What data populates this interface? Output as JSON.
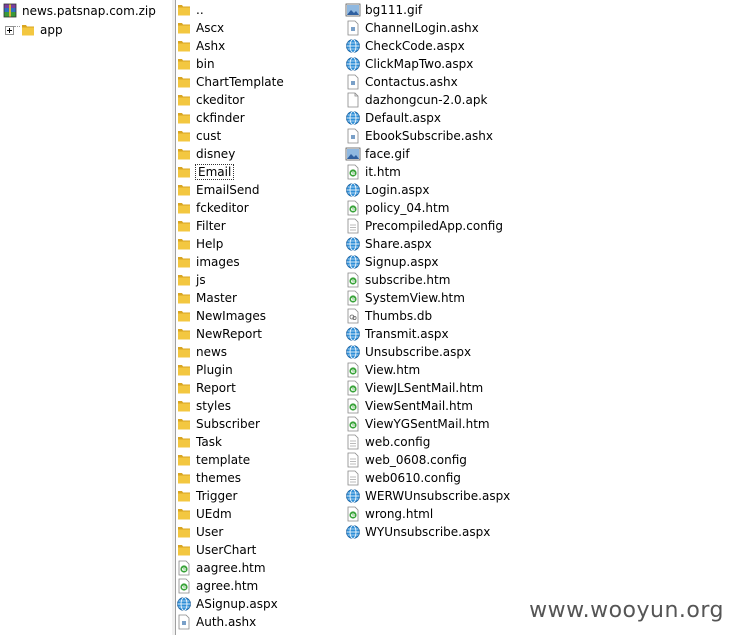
{
  "tree": {
    "root_label": "news.patsnap.com.zip",
    "child_label": "app"
  },
  "column1": [
    {
      "name": "..",
      "icon": "folder-icon"
    },
    {
      "name": "Ascx",
      "icon": "folder-icon"
    },
    {
      "name": "Ashx",
      "icon": "folder-icon"
    },
    {
      "name": "bin",
      "icon": "folder-icon"
    },
    {
      "name": "ChartTemplate",
      "icon": "folder-icon"
    },
    {
      "name": "ckeditor",
      "icon": "folder-icon"
    },
    {
      "name": "ckfinder",
      "icon": "folder-icon"
    },
    {
      "name": "cust",
      "icon": "folder-icon"
    },
    {
      "name": "disney",
      "icon": "folder-icon"
    },
    {
      "name": "Email",
      "icon": "folder-icon",
      "selected": true
    },
    {
      "name": "EmailSend",
      "icon": "folder-icon"
    },
    {
      "name": "fckeditor",
      "icon": "folder-icon"
    },
    {
      "name": "Filter",
      "icon": "folder-icon"
    },
    {
      "name": "Help",
      "icon": "folder-icon"
    },
    {
      "name": "images",
      "icon": "folder-icon"
    },
    {
      "name": "js",
      "icon": "folder-icon"
    },
    {
      "name": "Master",
      "icon": "folder-icon"
    },
    {
      "name": "NewImages",
      "icon": "folder-icon"
    },
    {
      "name": "NewReport",
      "icon": "folder-icon"
    },
    {
      "name": "news",
      "icon": "folder-icon"
    },
    {
      "name": "Plugin",
      "icon": "folder-icon"
    },
    {
      "name": "Report",
      "icon": "folder-icon"
    },
    {
      "name": "styles",
      "icon": "folder-icon"
    },
    {
      "name": "Subscriber",
      "icon": "folder-icon"
    },
    {
      "name": "Task",
      "icon": "folder-icon"
    },
    {
      "name": "template",
      "icon": "folder-icon"
    },
    {
      "name": "themes",
      "icon": "folder-icon"
    },
    {
      "name": "Trigger",
      "icon": "folder-icon"
    },
    {
      "name": "UEdm",
      "icon": "folder-icon"
    },
    {
      "name": "User",
      "icon": "folder-icon"
    },
    {
      "name": "UserChart",
      "icon": "folder-icon"
    },
    {
      "name": "aagree.htm",
      "icon": "html-file-icon"
    },
    {
      "name": "agree.htm",
      "icon": "html-file-icon"
    },
    {
      "name": "ASignup.aspx",
      "icon": "aspx-file-icon"
    },
    {
      "name": "Auth.ashx",
      "icon": "ashx-file-icon"
    }
  ],
  "column2": [
    {
      "name": "bg111.gif",
      "icon": "image-file-icon"
    },
    {
      "name": "ChannelLogin.ashx",
      "icon": "ashx-file-icon"
    },
    {
      "name": "CheckCode.aspx",
      "icon": "aspx-file-icon"
    },
    {
      "name": "ClickMapTwo.aspx",
      "icon": "aspx-file-icon"
    },
    {
      "name": "Contactus.ashx",
      "icon": "ashx-file-icon"
    },
    {
      "name": "dazhongcun-2.0.apk",
      "icon": "blank-file-icon"
    },
    {
      "name": "Default.aspx",
      "icon": "aspx-file-icon"
    },
    {
      "name": "EbookSubscribe.ashx",
      "icon": "ashx-file-icon"
    },
    {
      "name": "face.gif",
      "icon": "image-file-icon"
    },
    {
      "name": "it.htm",
      "icon": "html-file-icon"
    },
    {
      "name": "Login.aspx",
      "icon": "aspx-file-icon"
    },
    {
      "name": "policy_04.htm",
      "icon": "html-file-icon"
    },
    {
      "name": "PrecompiledApp.config",
      "icon": "config-file-icon"
    },
    {
      "name": "Share.aspx",
      "icon": "aspx-file-icon"
    },
    {
      "name": "Signup.aspx",
      "icon": "aspx-file-icon"
    },
    {
      "name": "subscribe.htm",
      "icon": "html-file-icon"
    },
    {
      "name": "SystemView.htm",
      "icon": "html-file-icon"
    },
    {
      "name": "Thumbs.db",
      "icon": "db-file-icon"
    },
    {
      "name": "Transmit.aspx",
      "icon": "aspx-file-icon"
    },
    {
      "name": "Unsubscribe.aspx",
      "icon": "aspx-file-icon"
    },
    {
      "name": "View.htm",
      "icon": "html-file-icon"
    },
    {
      "name": "ViewJLSentMail.htm",
      "icon": "html-file-icon"
    },
    {
      "name": "ViewSentMail.htm",
      "icon": "html-file-icon"
    },
    {
      "name": "ViewYGSentMail.htm",
      "icon": "html-file-icon"
    },
    {
      "name": "web.config",
      "icon": "config-file-icon"
    },
    {
      "name": "web_0608.config",
      "icon": "config-file-icon"
    },
    {
      "name": "web0610.config",
      "icon": "config-file-icon"
    },
    {
      "name": "WERWUnsubscribe.aspx",
      "icon": "aspx-file-icon"
    },
    {
      "name": "wrong.html",
      "icon": "html-file-icon"
    },
    {
      "name": "WYUnsubscribe.aspx",
      "icon": "aspx-file-icon"
    }
  ],
  "watermark": "www.wooyun.org",
  "colors": {
    "folder": "#f3c740",
    "folder_dark": "#d9a521",
    "aspx_globe": "#2e8fd8",
    "html_e": "#3aa33a",
    "selection_border": "#333333"
  }
}
